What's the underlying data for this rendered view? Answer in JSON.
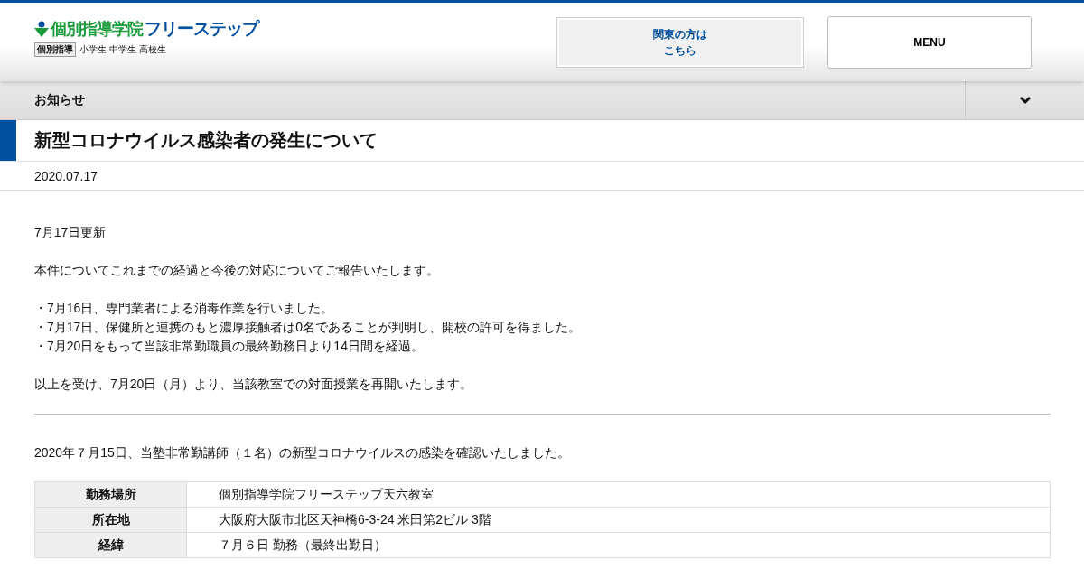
{
  "header": {
    "logo": {
      "school": "個別指導学院",
      "brand": "フリーステップ"
    },
    "tagline": {
      "tag": "個別指導",
      "grades": "小学生 中学生 高校生"
    },
    "region_button": [
      "関東の方は",
      "こちら"
    ],
    "menu_button": "MENU"
  },
  "category_bar": {
    "label": "お知らせ",
    "expanded": false
  },
  "article": {
    "title": "新型コロナウイルス感染者の発生について",
    "date": "2020.07.17",
    "update": [
      "7月17日更新",
      "本件についてこれまでの経過と今後の対応についてご報告いたします。",
      [
        "・7月16日、専門業者による消毒作業を行いました。",
        "・7月17日、保健所と連携のもと濃厚接触者は0名であることが判明し、開校の許可を得ました。",
        "・7月20日をもって当該非常勤職員の最終勤務日より14日間を経過。"
      ],
      "以上を受け、7月20日（月）より、当該教室での対面授業を再開いたします。"
    ],
    "intro": "2020年７月15日、当塾非常勤講師（１名）の新型コロナウイルスの感染を確認いたしました。",
    "table": [
      {
        "label": "勤務場所",
        "value": "個別指導学院フリーステップ天六教室"
      },
      {
        "label": "所在地",
        "value": "大阪府大阪市北区天神橋6-3-24 米田第2ビル 3階"
      },
      {
        "label": "経緯",
        "value": "７月６日 勤務（最終出勤日）"
      }
    ]
  }
}
